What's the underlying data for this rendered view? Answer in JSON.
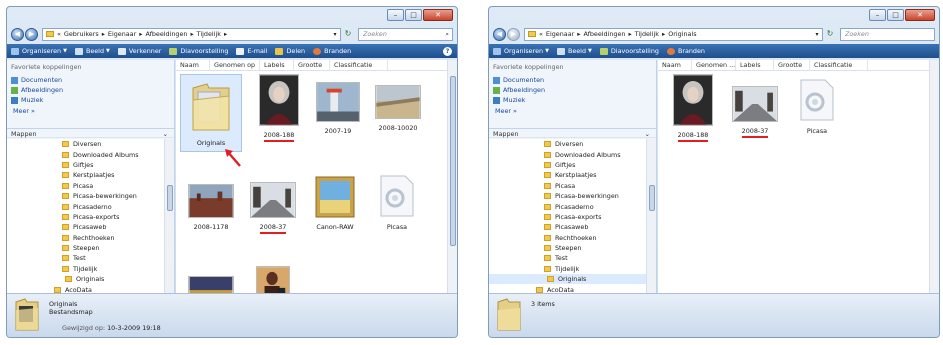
{
  "windows": [
    {
      "address_crumbs": [
        "Gebruikers",
        "Eigenaar",
        "Afbeeldingen",
        "Tijdelijk"
      ],
      "search_placeholder": "Zoeken",
      "toolbar": [
        "Organiseren",
        "Beeld",
        "Verkenner",
        "Diavoorstelling",
        "E-mail",
        "Delen",
        "Branden"
      ],
      "favorites_header": "Favoriete koppelingen",
      "favorites": [
        "Documenten",
        "Afbeeldingen",
        "Muziek"
      ],
      "more_label": "Meer »",
      "folders_label": "Mappen",
      "tree": [
        {
          "label": "Diversen",
          "level": "child"
        },
        {
          "label": "Downloaded Albums",
          "level": "child"
        },
        {
          "label": "Giftjes",
          "level": "child"
        },
        {
          "label": "Kerstplaatjes",
          "level": "child"
        },
        {
          "label": "Picasa",
          "level": "child"
        },
        {
          "label": "Picasa-bewerkingen",
          "level": "child"
        },
        {
          "label": "Picasaderno",
          "level": "child"
        },
        {
          "label": "Picasa-exports",
          "level": "child"
        },
        {
          "label": "Picasaweb",
          "level": "child"
        },
        {
          "label": "Rechthoeken",
          "level": "child"
        },
        {
          "label": "Steepen",
          "level": "child"
        },
        {
          "label": "Test",
          "level": "child"
        },
        {
          "label": "Tijdelijk",
          "level": "child"
        },
        {
          "label": "Originals",
          "level": "sub"
        },
        {
          "label": "AcoData",
          "level": "root"
        }
      ],
      "columns": [
        "Naam",
        "Genomen op",
        "Labels",
        "Grootte",
        "Classificatie"
      ],
      "items": [
        "Originals",
        "2008-188",
        "2007-19",
        "2008-10020",
        "2008-1178",
        "2008-37",
        "Canon-RAW",
        "Picasa"
      ],
      "details": {
        "name": "Originals",
        "type": "Bestandsmap",
        "modified_label": "Gewijzigd op:",
        "modified_value": "10-3-2009 19:18"
      }
    },
    {
      "address_crumbs": [
        "Eigenaar",
        "Afbeeldingen",
        "Tijdelijk",
        "Originals"
      ],
      "search_placeholder": "Zoeken",
      "toolbar": [
        "Organiseren",
        "Beeld",
        "Diavoorstelling",
        "Branden"
      ],
      "favorites_header": "Favoriete koppelingen",
      "favorites": [
        "Documenten",
        "Afbeeldingen",
        "Muziek"
      ],
      "more_label": "Meer »",
      "folders_label": "Mappen",
      "tree": [
        {
          "label": "Diversen",
          "level": "child"
        },
        {
          "label": "Downloaded Albums",
          "level": "child"
        },
        {
          "label": "Giftjes",
          "level": "child"
        },
        {
          "label": "Kerstplaatjes",
          "level": "child"
        },
        {
          "label": "Picasa",
          "level": "child"
        },
        {
          "label": "Picasa-bewerkingen",
          "level": "child"
        },
        {
          "label": "Picasaderno",
          "level": "child"
        },
        {
          "label": "Picasa-exports",
          "level": "child"
        },
        {
          "label": "Picasaweb",
          "level": "child"
        },
        {
          "label": "Rechthoeken",
          "level": "child"
        },
        {
          "label": "Steepen",
          "level": "child"
        },
        {
          "label": "Test",
          "level": "child"
        },
        {
          "label": "Tijdelijk",
          "level": "child"
        },
        {
          "label": "Originals",
          "level": "sub"
        },
        {
          "label": "AcoData",
          "level": "root"
        }
      ],
      "columns": [
        "Naam",
        "Genomen ...",
        "Labels",
        "Grootte",
        "Classificatie"
      ],
      "items": [
        "2008-188",
        "2008-37",
        "Picasa"
      ],
      "details": {
        "count": "3 items"
      }
    }
  ],
  "colors": {
    "toolbar": "#2a5f9e",
    "link": "#16489a",
    "annotation": "#e02020"
  }
}
